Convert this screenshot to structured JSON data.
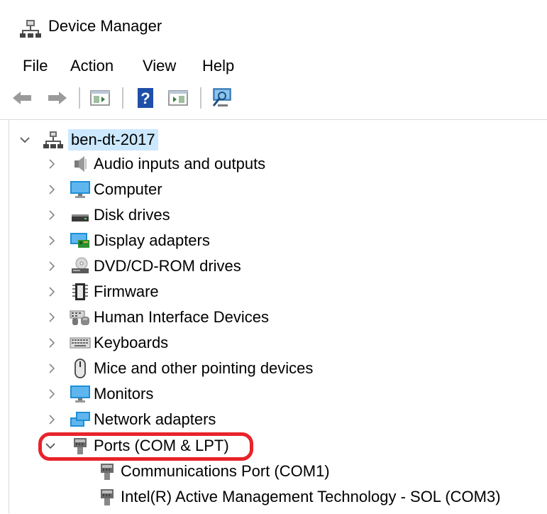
{
  "window": {
    "title": "Device Manager",
    "icon": "device-manager-icon"
  },
  "menu": [
    "File",
    "Action",
    "View",
    "Help"
  ],
  "toolbar": {
    "buttons": [
      "back-arrow-icon",
      "forward-arrow-icon",
      "show-hide-console-tree-icon",
      "help-icon",
      "show-hide-action-pane-icon",
      "scan-hardware-changes-icon"
    ]
  },
  "tree": {
    "root": {
      "label": "ben-dt-2017",
      "expanded": true,
      "selected": true
    },
    "categories": [
      {
        "label": "Audio inputs and outputs",
        "icon": "speaker-icon"
      },
      {
        "label": "Computer",
        "icon": "monitor-icon"
      },
      {
        "label": "Disk drives",
        "icon": "disk-drive-icon"
      },
      {
        "label": "Display adapters",
        "icon": "display-adapter-icon"
      },
      {
        "label": "DVD/CD-ROM drives",
        "icon": "optical-drive-icon"
      },
      {
        "label": "Firmware",
        "icon": "chip-icon"
      },
      {
        "label": "Human Interface Devices",
        "icon": "hid-icon"
      },
      {
        "label": "Keyboards",
        "icon": "keyboard-icon"
      },
      {
        "label": "Mice and other pointing devices",
        "icon": "mouse-icon"
      },
      {
        "label": "Monitors",
        "icon": "monitor-icon"
      },
      {
        "label": "Network adapters",
        "icon": "network-adapter-icon"
      },
      {
        "label": "Ports (COM & LPT)",
        "icon": "port-icon",
        "expanded": true
      }
    ],
    "ports_children": [
      {
        "label": "Communications Port (COM1)",
        "icon": "port-icon"
      },
      {
        "label": "Intel(R) Active Management Technology - SOL (COM3)",
        "icon": "port-icon"
      }
    ]
  },
  "colors": {
    "selection": "#cce8ff",
    "highlight_ring": "#e8232a"
  }
}
